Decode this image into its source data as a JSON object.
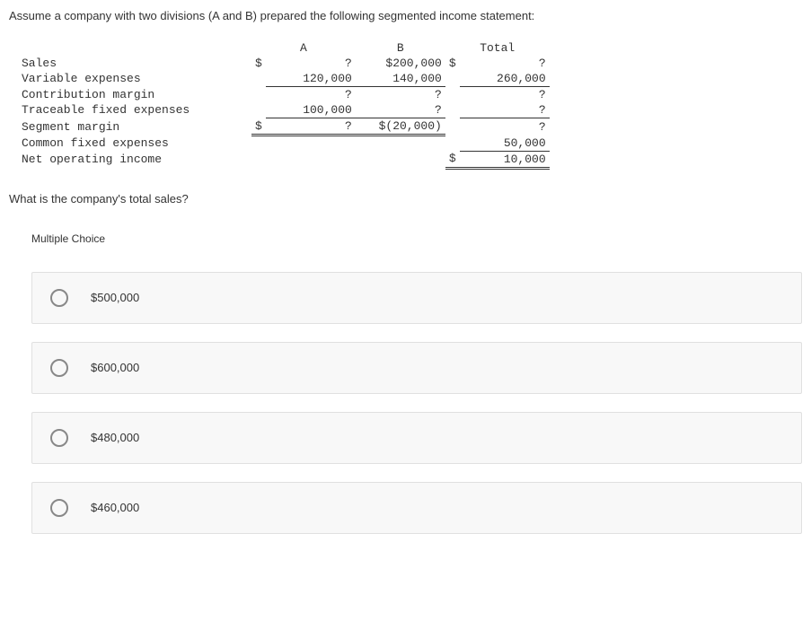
{
  "intro": "Assume a company with two divisions (A and B) prepared the following segmented income statement:",
  "table": {
    "headers": {
      "a": "A",
      "b": "B",
      "total": "Total"
    },
    "rows": {
      "sales": {
        "label": "Sales",
        "a_sym": "$",
        "a": "?",
        "b": "$200,000",
        "t_sym": "$",
        "t": "?"
      },
      "varexp": {
        "label": "Variable expenses",
        "a_sym": "",
        "a": "120,000",
        "b": "140,000",
        "t_sym": "",
        "t": "260,000"
      },
      "contrib": {
        "label": "Contribution margin",
        "a_sym": "",
        "a": "?",
        "b": "?",
        "t_sym": "",
        "t": "?"
      },
      "tracefix": {
        "label": "Traceable fixed expenses",
        "a_sym": "",
        "a": "100,000",
        "b": "?",
        "t_sym": "",
        "t": "?"
      },
      "segmarg": {
        "label": "Segment margin",
        "a_sym": "$",
        "a": "?",
        "b": "$(20,000)",
        "t_sym": "",
        "t": "?"
      },
      "commfix": {
        "label": "Common fixed expenses",
        "a_sym": "",
        "a": "",
        "b": "",
        "t_sym": "",
        "t": "50,000"
      },
      "netop": {
        "label": "Net operating income",
        "a_sym": "",
        "a": "",
        "b": "",
        "t_sym": "$",
        "t": "10,000"
      }
    }
  },
  "question": "What is the company's total sales?",
  "mc_label": "Multiple Choice",
  "choices": [
    {
      "label": "$500,000"
    },
    {
      "label": "$600,000"
    },
    {
      "label": "$480,000"
    },
    {
      "label": "$460,000"
    }
  ]
}
